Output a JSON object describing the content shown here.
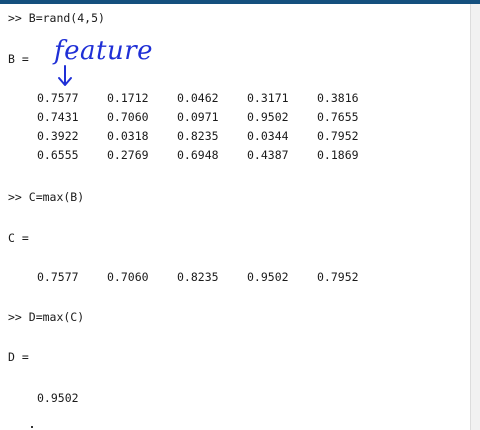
{
  "console": {
    "cmd1": ">> B=rand(4,5)",
    "b_label": "B =",
    "annotation": "feature",
    "matrix_b": [
      [
        "0.7577",
        "0.1712",
        "0.0462",
        "0.3171",
        "0.3816"
      ],
      [
        "0.7431",
        "0.7060",
        "0.0971",
        "0.9502",
        "0.7655"
      ],
      [
        "0.3922",
        "0.0318",
        "0.8235",
        "0.0344",
        "0.7952"
      ],
      [
        "0.6555",
        "0.2769",
        "0.6948",
        "0.4387",
        "0.1869"
      ]
    ],
    "cmd2": ">> C=max(B)",
    "c_label": "C =",
    "matrix_c": [
      "0.7577",
      "0.7060",
      "0.8235",
      "0.9502",
      "0.7952"
    ],
    "cmd3": ">> D=max(C)",
    "d_label": "D =",
    "d_value": "0.9502"
  },
  "colors": {
    "annotation": "#1f2fd6",
    "titlebar": "#15507e"
  },
  "icons": {
    "annotation_arrow": "down-arrow-icon"
  }
}
